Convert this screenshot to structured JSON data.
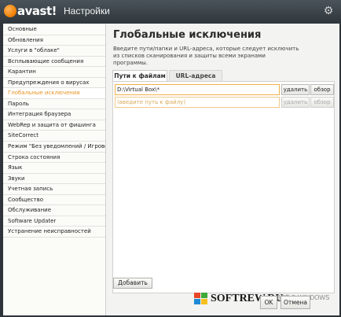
{
  "app": {
    "logo_text": "avast!",
    "window_title": "Настройки"
  },
  "sidebar": {
    "items": [
      {
        "label": "Основные",
        "active": false
      },
      {
        "label": "Обновления",
        "active": false
      },
      {
        "label": "Услуги в \"облаке\"",
        "active": false
      },
      {
        "label": "Всплывающие сообщения",
        "active": false
      },
      {
        "label": "Карантин",
        "active": false
      },
      {
        "label": "Предупреждения о вирусах",
        "active": false
      },
      {
        "label": "Глобальные исключения",
        "active": true
      },
      {
        "label": "Пароль",
        "active": false
      },
      {
        "label": "Интеграция браузера",
        "active": false
      },
      {
        "label": "WebRep и защита от фишинга",
        "active": false
      },
      {
        "label": "SiteCorrect",
        "active": false
      },
      {
        "label": "Режим \"Без уведомлений / Игровой\"",
        "active": false
      },
      {
        "label": "Строка состояния",
        "active": false
      },
      {
        "label": "Язык",
        "active": false
      },
      {
        "label": "Звуки",
        "active": false
      },
      {
        "label": "Учетная запись",
        "active": false
      },
      {
        "label": "Сообщество",
        "active": false
      },
      {
        "label": "Обслуживание",
        "active": false
      },
      {
        "label": "Software Updater",
        "active": false
      },
      {
        "label": "Устранение неисправностей",
        "active": false
      }
    ]
  },
  "main": {
    "heading": "Глобальные исключения",
    "description": "Введите пути/папки и URL-адреса, которые следует исключить из списков сканирования и защиты всеми экранами программы.",
    "tabs": [
      {
        "label": "Пути к файлам",
        "active": true
      },
      {
        "label": "URL-адреса",
        "active": false
      }
    ],
    "rows": [
      {
        "value": "D:\\Virtual Box\\*",
        "placeholder": "",
        "remove_label": "удалить",
        "browse_label": "обзор",
        "enabled": true
      },
      {
        "value": "",
        "placeholder": "(введите путь к файлу)",
        "remove_label": "удалить",
        "browse_label": "обзор",
        "enabled": false
      }
    ],
    "add_button": "Добавить"
  },
  "footer": {
    "ok_label": "OK",
    "cancel_label": "Отмена"
  },
  "watermark": {
    "text": "SOFTREW.RU",
    "subtext": "ВСЁ О WINDOWS"
  },
  "colors": {
    "accent": "#e8921f",
    "titlebar": "#3a4248",
    "input_border": "#f0b04a"
  }
}
